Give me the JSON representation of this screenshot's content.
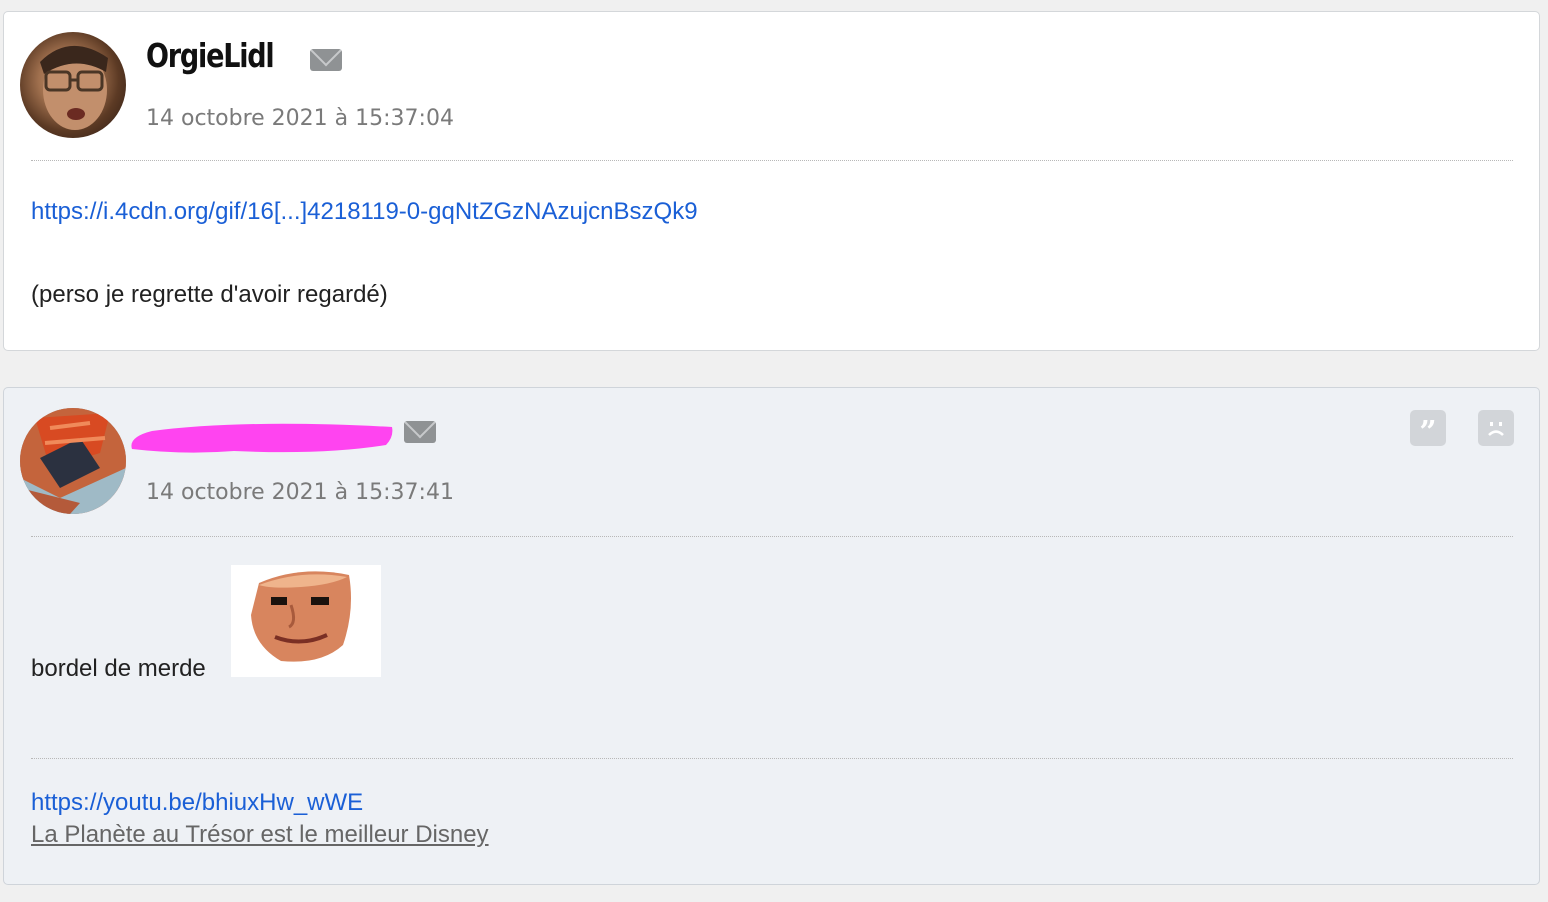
{
  "posts": [
    {
      "author": "OrgieLidl",
      "date": "14 octobre 2021 à 15:37:04",
      "link": "https://i.4cdn.org/gif/16[...]4218119-0-gqNtZGzNAzujcnBszQk9",
      "text": "(perso je regrette d'avoir regardé)"
    },
    {
      "author": "",
      "date": "14 octobre 2021 à 15:37:41",
      "text": "bordel de merde",
      "signature": {
        "link": "https://youtu.be/bhiuxHw_wWE",
        "text": "La Planète au Trésor est le meilleur Disney"
      }
    }
  ],
  "icons": {
    "mail": "mail-icon",
    "quote": "quote-icon",
    "report": "sad-face-icon"
  },
  "colors": {
    "link": "#1a5fd6",
    "redaction": "#ff44f0"
  }
}
